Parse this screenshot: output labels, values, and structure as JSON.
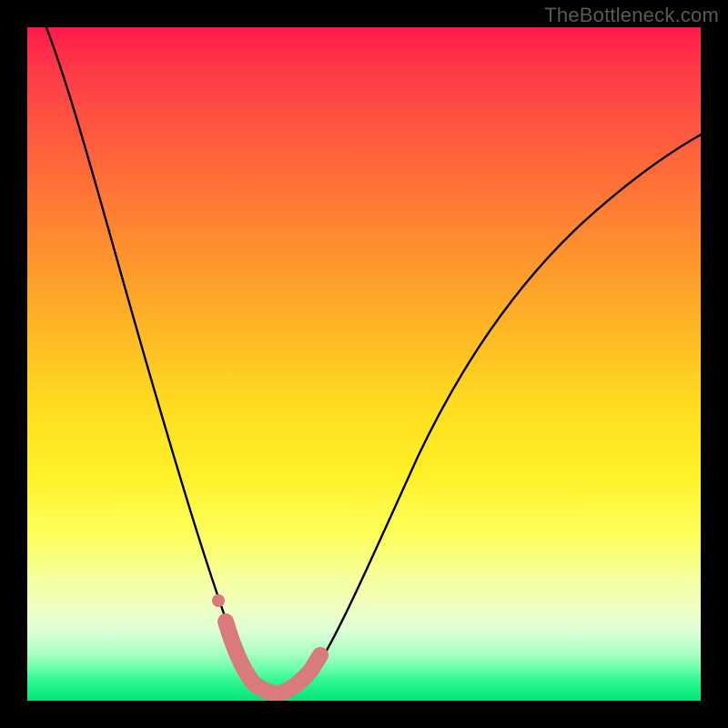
{
  "watermark": "TheBottleneck.com",
  "chart_data": {
    "type": "line",
    "title": "",
    "xlabel": "",
    "ylabel": "",
    "xlim": [
      0,
      100
    ],
    "ylim": [
      0,
      100
    ],
    "grid": false,
    "legend": false,
    "background": "vertical-gradient red-to-green",
    "series": [
      {
        "name": "bottleneck-curve",
        "x": [
          2,
          5,
          8,
          11,
          14,
          17,
          20,
          23,
          25,
          27,
          29,
          31,
          33,
          35,
          37,
          40,
          44,
          48,
          54,
          60,
          66,
          72,
          78,
          84,
          90,
          96,
          100
        ],
        "y": [
          102,
          90,
          78,
          66,
          55,
          45,
          36,
          28,
          22,
          17,
          12,
          8,
          5,
          3,
          2,
          2,
          4,
          9,
          18,
          30,
          41,
          51,
          59,
          66,
          72,
          77,
          80
        ]
      }
    ],
    "annotations": [
      {
        "name": "optimal-range-highlight",
        "type": "path-overlay",
        "color": "#d97a7d",
        "x": [
          29,
          31,
          33,
          35,
          37,
          40,
          43
        ],
        "y": [
          12,
          8,
          5,
          3,
          2,
          2,
          4
        ]
      },
      {
        "name": "marker-dot",
        "type": "point",
        "color": "#d97a7d",
        "x": 27.5,
        "y": 15
      }
    ]
  }
}
